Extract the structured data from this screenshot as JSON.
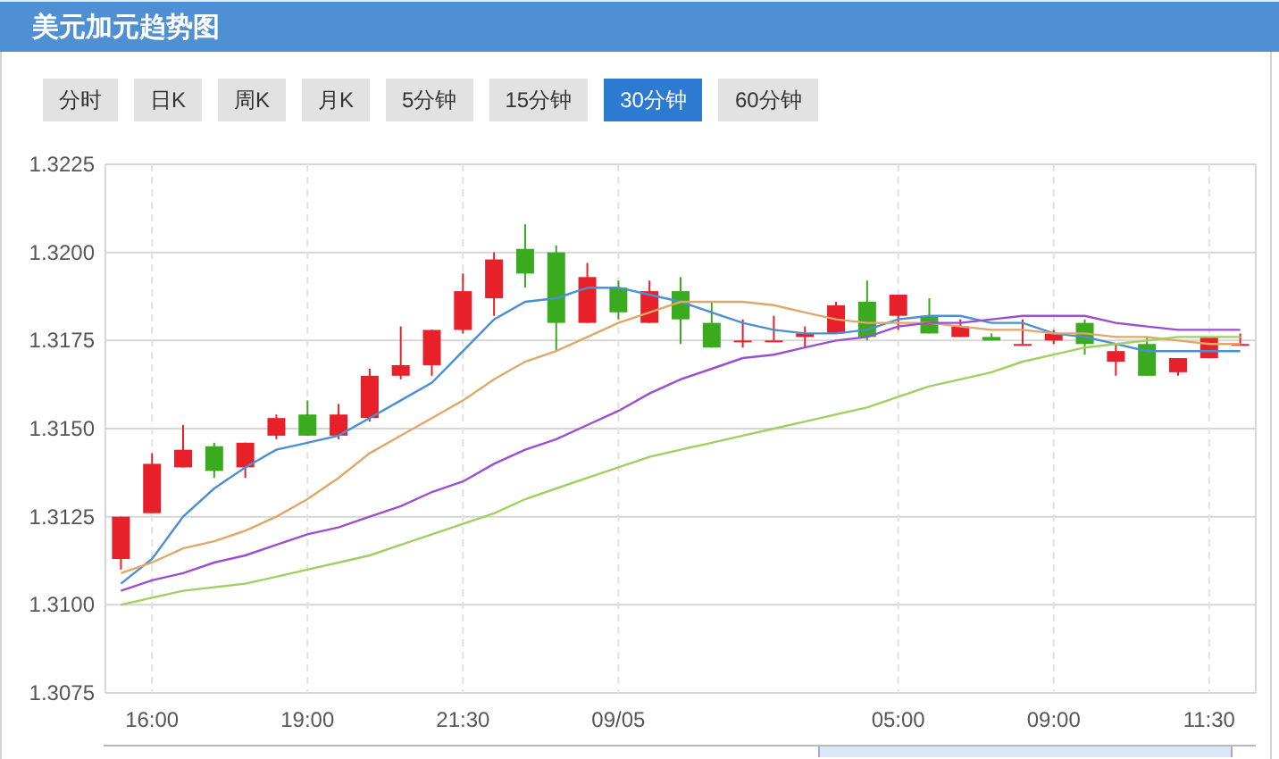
{
  "header": {
    "title": "美元加元趋势图"
  },
  "period_tabs": [
    {
      "label": "分时",
      "selected": false
    },
    {
      "label": "日K",
      "selected": false
    },
    {
      "label": "周K",
      "selected": false
    },
    {
      "label": "月K",
      "selected": false
    },
    {
      "label": "5分钟",
      "selected": false
    },
    {
      "label": "15分钟",
      "selected": false
    },
    {
      "label": "30分钟",
      "selected": true
    },
    {
      "label": "60分钟",
      "selected": false
    }
  ],
  "chart": {
    "chart_data": {
      "type": "candlestick",
      "grid": true,
      "ylim": [
        1.3075,
        1.3225
      ],
      "categories": [
        null,
        "16:00",
        null,
        null,
        null,
        null,
        "19:00",
        null,
        null,
        null,
        null,
        "21:30",
        null,
        null,
        null,
        null,
        "09/05",
        null,
        null,
        null,
        null,
        null,
        null,
        null,
        null,
        "05:00",
        null,
        null,
        null,
        null,
        "09:00",
        null,
        null,
        null,
        null,
        "11:30",
        null
      ],
      "yticks": [
        {
          "value": 1.3075,
          "label": "1.3075"
        },
        {
          "value": 1.31,
          "label": "1.3100"
        },
        {
          "value": 1.3125,
          "label": "1.3125"
        },
        {
          "value": 1.315,
          "label": "1.3150"
        },
        {
          "value": 1.3175,
          "label": "1.3175"
        },
        {
          "value": 1.32,
          "label": "1.3200"
        },
        {
          "value": 1.3225,
          "label": "1.3225"
        }
      ],
      "ohlc": [
        [
          1.3113,
          1.3125,
          1.311,
          1.3125
        ],
        [
          1.3126,
          1.3143,
          1.3126,
          1.314
        ],
        [
          1.3139,
          1.3151,
          1.3139,
          1.3144
        ],
        [
          1.3145,
          1.3146,
          1.3136,
          1.3138
        ],
        [
          1.3139,
          1.3146,
          1.3136,
          1.3146
        ],
        [
          1.3148,
          1.3154,
          1.3147,
          1.3153
        ],
        [
          1.3154,
          1.3158,
          1.3148,
          1.3148
        ],
        [
          1.3148,
          1.3157,
          1.3147,
          1.3154
        ],
        [
          1.3153,
          1.3167,
          1.3152,
          1.3165
        ],
        [
          1.3165,
          1.3179,
          1.3164,
          1.3168
        ],
        [
          1.3168,
          1.3178,
          1.3165,
          1.3178
        ],
        [
          1.3178,
          1.3194,
          1.3177,
          1.3189
        ],
        [
          1.3187,
          1.32,
          1.3182,
          1.3198
        ],
        [
          1.3201,
          1.3208,
          1.319,
          1.3194
        ],
        [
          1.32,
          1.3202,
          1.3172,
          1.318
        ],
        [
          1.318,
          1.3197,
          1.318,
          1.3193
        ],
        [
          1.319,
          1.3192,
          1.3181,
          1.3183
        ],
        [
          1.318,
          1.3192,
          1.318,
          1.3189
        ],
        [
          1.3189,
          1.3193,
          1.3174,
          1.3181
        ],
        [
          1.318,
          1.3186,
          1.3173,
          1.3173
        ],
        [
          1.3175,
          1.3181,
          1.3173,
          1.3175
        ],
        [
          1.3175,
          1.3182,
          1.3175,
          1.3175
        ],
        [
          1.3176,
          1.3179,
          1.3173,
          1.3177
        ],
        [
          1.3177,
          1.3186,
          1.3177,
          1.3185
        ],
        [
          1.3186,
          1.3192,
          1.3175,
          1.3176
        ],
        [
          1.3182,
          1.3188,
          1.3178,
          1.3188
        ],
        [
          1.3182,
          1.3187,
          1.3177,
          1.3177
        ],
        [
          1.3176,
          1.3181,
          1.3176,
          1.3179
        ],
        [
          1.3176,
          1.3177,
          1.3175,
          1.3175
        ],
        [
          1.3174,
          1.3181,
          1.3174,
          1.3174
        ],
        [
          1.3175,
          1.3178,
          1.3174,
          1.3177
        ],
        [
          1.318,
          1.3181,
          1.3171,
          1.3174
        ],
        [
          1.3169,
          1.3174,
          1.3165,
          1.3172
        ],
        [
          1.3174,
          1.3176,
          1.3165,
          1.3165
        ],
        [
          1.3166,
          1.317,
          1.3165,
          1.317
        ],
        [
          1.317,
          1.3176,
          1.317,
          1.3176
        ],
        [
          1.3174,
          1.3177,
          1.3174,
          1.3174
        ]
      ],
      "series": [
        {
          "type": "line",
          "color": "#4a8fd6",
          "values": [
            1.3106,
            1.3113,
            1.3125,
            1.3133,
            1.3139,
            1.3144,
            1.3146,
            1.3148,
            1.3153,
            1.3158,
            1.3163,
            1.3172,
            1.3181,
            1.3186,
            1.3187,
            1.319,
            1.319,
            1.3188,
            1.3186,
            1.3183,
            1.318,
            1.3178,
            1.3177,
            1.3177,
            1.3178,
            1.3181,
            1.3182,
            1.3182,
            1.318,
            1.318,
            1.3177,
            1.3176,
            1.3174,
            1.3172,
            1.3172,
            1.3172,
            1.3172
          ]
        },
        {
          "type": "line",
          "color": "#e0a868",
          "values": [
            1.3109,
            1.3112,
            1.3116,
            1.3118,
            1.3121,
            1.3125,
            1.313,
            1.3136,
            1.3143,
            1.3148,
            1.3153,
            1.3158,
            1.3164,
            1.3169,
            1.3172,
            1.3176,
            1.318,
            1.3183,
            1.3186,
            1.3186,
            1.3186,
            1.3185,
            1.3183,
            1.3181,
            1.318,
            1.318,
            1.318,
            1.3179,
            1.3178,
            1.3178,
            1.3177,
            1.3177,
            1.3176,
            1.3176,
            1.3175,
            1.3174,
            1.3174
          ]
        },
        {
          "type": "line",
          "color": "#9b4fd0",
          "values": [
            1.3104,
            1.3107,
            1.3109,
            1.3112,
            1.3114,
            1.3117,
            1.312,
            1.3122,
            1.3125,
            1.3128,
            1.3132,
            1.3135,
            1.314,
            1.3144,
            1.3147,
            1.3151,
            1.3155,
            1.316,
            1.3164,
            1.3167,
            1.317,
            1.3171,
            1.3173,
            1.3175,
            1.3176,
            1.3179,
            1.318,
            1.318,
            1.3181,
            1.3182,
            1.3182,
            1.3182,
            1.318,
            1.3179,
            1.3178,
            1.3178,
            1.3178
          ]
        },
        {
          "type": "line",
          "color": "#9fd060",
          "values": [
            1.31,
            1.3102,
            1.3104,
            1.3105,
            1.3106,
            1.3108,
            1.311,
            1.3112,
            1.3114,
            1.3117,
            1.312,
            1.3123,
            1.3126,
            1.313,
            1.3133,
            1.3136,
            1.3139,
            1.3142,
            1.3144,
            1.3146,
            1.3148,
            1.315,
            1.3152,
            1.3154,
            1.3156,
            1.3159,
            1.3162,
            1.3164,
            1.3166,
            1.3169,
            1.3171,
            1.3173,
            1.3174,
            1.3175,
            1.3176,
            1.3176,
            1.3176
          ]
        }
      ]
    }
  }
}
